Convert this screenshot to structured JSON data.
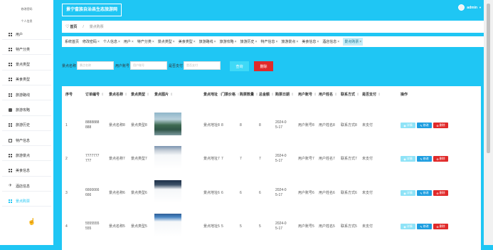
{
  "app": {
    "title": "景宁畲族自治县生态旅游网"
  },
  "user": {
    "name": "admin"
  },
  "sidebar": {
    "top_links": [
      "修改密码",
      "个人信息"
    ],
    "items": [
      {
        "label": "用户",
        "icon": "grid-icon"
      },
      {
        "label": "特产分类",
        "icon": "grid-icon"
      },
      {
        "label": "景点类型",
        "icon": "grid-icon"
      },
      {
        "label": "美食类型",
        "icon": "grid-icon"
      },
      {
        "label": "旅游路线",
        "icon": "grid-icon"
      },
      {
        "label": "旅游攻略",
        "icon": "book-icon"
      },
      {
        "label": "旅游历史",
        "icon": "grid-icon"
      },
      {
        "label": "特产信息",
        "icon": "monitor-icon"
      },
      {
        "label": "旅游景点",
        "icon": "grid-icon"
      },
      {
        "label": "美食信息",
        "icon": "grid-icon"
      },
      {
        "label": "酒店信息",
        "icon": "plane-icon"
      },
      {
        "label": "景点购票",
        "icon": "grid-icon"
      }
    ]
  },
  "breadcrumb": {
    "home": "首页",
    "current": "景点购票"
  },
  "tabs": [
    "系统首页",
    "修改密码",
    "个人信息",
    "用户",
    "特产分类",
    "景点类型",
    "美食类型",
    "旅游路线",
    "旅游攻略",
    "旅游历史",
    "特产信息",
    "旅游景点",
    "美食信息",
    "酒店信息",
    "景点购票"
  ],
  "filters": {
    "name_label": "景点名称",
    "name_placeholder": "景点名称",
    "user_label": "用户账号",
    "user_placeholder": "用户账号",
    "paid_label": "是否支付",
    "paid_placeholder": "是否支付",
    "search_btn": "查询",
    "delete_btn": "删除"
  },
  "table": {
    "columns": [
      "序号",
      "订单编号",
      "景点名称",
      "景点类型",
      "景点图片",
      "景点地址",
      "门票价格",
      "购票数量",
      "总金额",
      "购票日期",
      "用户账号",
      "用户姓名",
      "联系方式",
      "是否支付",
      "操作"
    ],
    "rows": [
      {
        "idx": "1",
        "order": "8888888888",
        "name": "景点名称8",
        "type": "景点类型8",
        "addr": "景点地址8",
        "price": "8",
        "qty": "8",
        "total": "8",
        "date": "2024-05-17",
        "account": "用户账号8",
        "uname": "用户姓名8",
        "contact": "联系方式8",
        "paid": "未支付"
      },
      {
        "idx": "2",
        "order": "7777777777",
        "name": "景点名称7",
        "type": "景点类型7",
        "addr": "景点地址7",
        "price": "7",
        "qty": "7",
        "total": "7",
        "date": "2024-05-17",
        "account": "用户账号7",
        "uname": "用户姓名7",
        "contact": "联系方式7",
        "paid": "未支付"
      },
      {
        "idx": "3",
        "order": "6666666666",
        "name": "景点名称6",
        "type": "景点类型6",
        "addr": "景点地址6",
        "price": "6",
        "qty": "6",
        "total": "6",
        "date": "2024-05-17",
        "account": "用户账号6",
        "uname": "用户姓名6",
        "contact": "联系方式6",
        "paid": "未支付"
      },
      {
        "idx": "4",
        "order": "5555555555",
        "name": "景点名称5",
        "type": "景点类型5",
        "addr": "景点地址5",
        "price": "5",
        "qty": "5",
        "total": "5",
        "date": "2024-05-17",
        "account": "用户账号5",
        "uname": "用户姓名5",
        "contact": "联系方式5",
        "paid": "未支付"
      }
    ],
    "actions": {
      "detail": "详情",
      "edit": "修改",
      "delete": "删除"
    }
  },
  "watermark": "CSDN @青青   计算机毕设源码程序",
  "colors": {
    "accent": "#1fc6f4",
    "danger": "#e02a2a",
    "edit": "#1e9ee0"
  }
}
